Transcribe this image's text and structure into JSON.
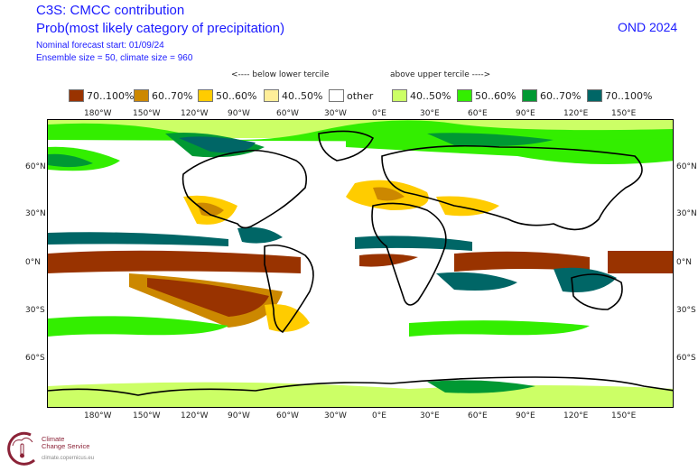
{
  "header": {
    "title": "C3S: CMCC contribution",
    "subtitle": "Prob(most likely category of precipitation)",
    "forecast_start": "Nominal forecast start: 01/09/24",
    "ensemble_info": "Ensemble size = 50, climate size = 960",
    "season": "OND 2024"
  },
  "legend": {
    "below_heading": "<---- below lower tercile",
    "above_heading": "above upper tercile ---->",
    "items": [
      {
        "label": "70..100%",
        "color": "#993300",
        "category": "below"
      },
      {
        "label": "60..70%",
        "color": "#cc8800",
        "category": "below"
      },
      {
        "label": "50..60%",
        "color": "#ffcc00",
        "category": "below"
      },
      {
        "label": "40..50%",
        "color": "#ffee99",
        "category": "below"
      },
      {
        "label": "other",
        "color": "#ffffff",
        "category": "other"
      },
      {
        "label": "40..50%",
        "color": "#ccff66",
        "category": "above"
      },
      {
        "label": "50..60%",
        "color": "#33ee00",
        "category": "above"
      },
      {
        "label": "60..70%",
        "color": "#009933",
        "category": "above"
      },
      {
        "label": "70..100%",
        "color": "#006666",
        "category": "above"
      }
    ]
  },
  "axes": {
    "lon_ticks": [
      "180°W",
      "150°W",
      "120°W",
      "90°W",
      "60°W",
      "30°W",
      "0°E",
      "30°E",
      "60°E",
      "90°E",
      "120°E",
      "150°E"
    ],
    "lat_ticks": [
      "60°N",
      "30°N",
      "0°N",
      "30°S",
      "60°S"
    ]
  },
  "logo": {
    "line1": "Climate",
    "line2": "Change Service",
    "url": "climate.copernicus.eu",
    "color": "#8b2237"
  }
}
